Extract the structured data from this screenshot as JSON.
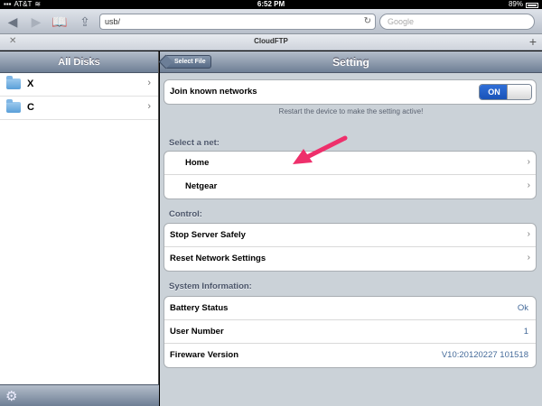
{
  "status": {
    "carrier": "AT&T",
    "time": "6:52 PM",
    "battery": "89%"
  },
  "browser": {
    "url": "usb/",
    "search_placeholder": "Google",
    "tab_title": "CloudFTP"
  },
  "left": {
    "title": "All Disks",
    "disks": [
      {
        "label": "X"
      },
      {
        "label": "C"
      }
    ]
  },
  "right": {
    "back_label": "Select File",
    "title": "Setting",
    "join_label": "Join known networks",
    "toggle_label": "ON",
    "join_note": "Restart the device to make the setting active!",
    "select_net_title": "Select a net:",
    "nets": [
      {
        "label": "Home"
      },
      {
        "label": "Netgear"
      }
    ],
    "control_title": "Control:",
    "controls": [
      {
        "label": "Stop Server Safely"
      },
      {
        "label": "Reset Network Settings"
      }
    ],
    "system_title": "System Information:",
    "system": [
      {
        "label": "Battery Status",
        "value": "Ok"
      },
      {
        "label": "User Number",
        "value": "1"
      },
      {
        "label": "Fireware Version",
        "value": "V10:20120227 101518"
      }
    ]
  },
  "colors": {
    "accent": "#1a53b8",
    "annotation_arrow": "#ee2f6b"
  }
}
